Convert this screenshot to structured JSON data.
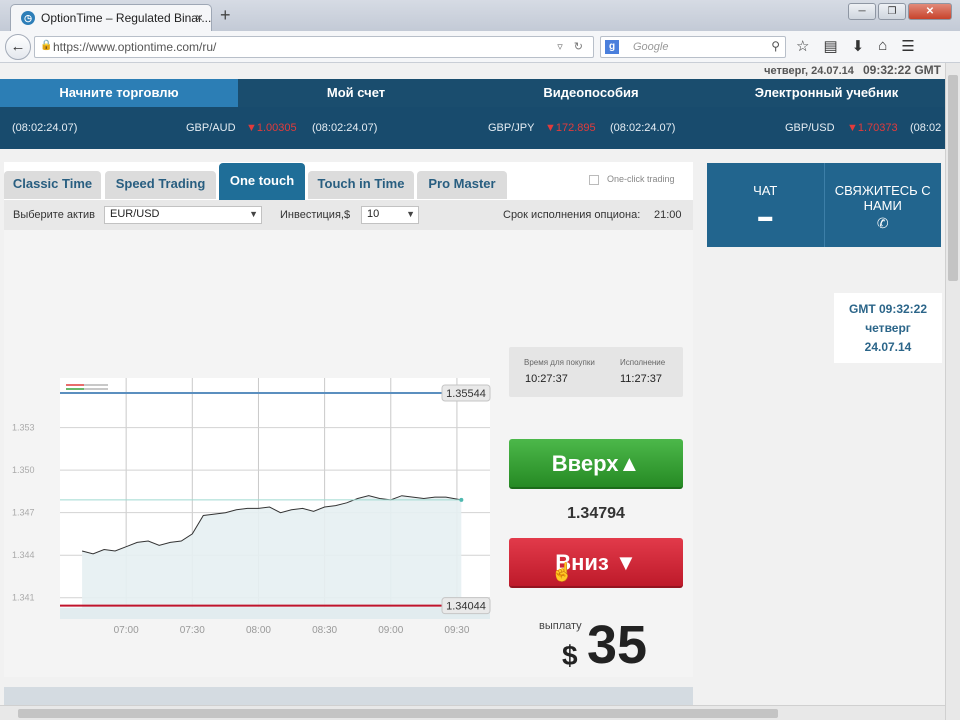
{
  "browser": {
    "tab_title": "OptionTime – Regulated Binar...",
    "tab_close": "×",
    "new_tab": "+",
    "url": "https://www.optiontime.com/ru/",
    "search_engine": "Google",
    "search_placeholder": "Google",
    "win_min": "─",
    "win_max": "❐",
    "win_close": "✕"
  },
  "site": {
    "date_line": "четверг, 24.07.14",
    "time_line": "09:32:22 GMT",
    "nav": [
      "Начните торговлю",
      "Мой счет",
      "Видеопособия",
      "Электронный учебник"
    ],
    "ticker": [
      {
        "time": "(08:02:24.07)",
        "pair": "GBP/AUD",
        "change": "▼1.00305"
      },
      {
        "time": "(08:02:24.07)",
        "pair": "GBP/JPY",
        "change": "▼172.895"
      },
      {
        "time": "(08:02:24.07)",
        "pair": "GBP/USD",
        "change": "▼1.70373"
      },
      {
        "time": "(08:02"
      }
    ]
  },
  "trade": {
    "tabs": [
      "Classic Time",
      "Speed Trading",
      "One touch",
      "Touch in Time",
      "Pro Master"
    ],
    "active_tab": "One touch",
    "one_click_label": "One-click trading",
    "asset_label": "Выберите актив",
    "asset_value": "EUR/USD",
    "invest_label": "Инвестиция,$",
    "invest_value": "10",
    "expiry_label": "Срок исполнения опциона:",
    "expiry_value": "21:00",
    "purchase_time_label": "Время для покупки",
    "purchase_time": "10:27:37",
    "execution_label": "Исполнение",
    "execution_time": "11:27:37",
    "up_label": "Вверх▲",
    "current_price": "1.34794",
    "down_label": "Вниз ▼",
    "payout_label": "выплату",
    "payout_currency": "$",
    "payout_value": "35"
  },
  "chart_data": {
    "type": "line",
    "x_ticks": [
      "07:00",
      "07:30",
      "08:00",
      "08:30",
      "09:00",
      "09:30"
    ],
    "y_ticks": [
      "1.353",
      "1.350",
      "1.347",
      "1.344",
      "1.341"
    ],
    "upper_barrier": "1.35544",
    "lower_barrier": "1.34044",
    "colors": {
      "upper": "#5b8fbf",
      "lower": "#c0142c",
      "price": "#333333",
      "fill": "#e6f0f2"
    },
    "series": [
      {
        "x": [
          "06:40",
          "06:45",
          "06:50",
          "06:55",
          "07:00",
          "07:05",
          "07:10",
          "07:15",
          "07:20",
          "07:25",
          "07:30",
          "07:35",
          "07:40",
          "07:45",
          "07:50",
          "07:55",
          "08:00",
          "08:05",
          "08:10",
          "08:15",
          "08:20",
          "08:25",
          "08:30",
          "08:35",
          "08:40",
          "08:45",
          "08:50",
          "08:55",
          "09:00",
          "09:05",
          "09:10",
          "09:15",
          "09:20",
          "09:25",
          "09:32"
        ],
        "values": [
          1.3443,
          1.3441,
          1.3444,
          1.3443,
          1.3446,
          1.3449,
          1.345,
          1.3447,
          1.3449,
          1.345,
          1.3455,
          1.3468,
          1.3469,
          1.347,
          1.3472,
          1.3473,
          1.3473,
          1.3474,
          1.347,
          1.3472,
          1.3473,
          1.3471,
          1.3474,
          1.3475,
          1.3477,
          1.348,
          1.3482,
          1.348,
          1.3479,
          1.3482,
          1.3481,
          1.348,
          1.3481,
          1.3481,
          1.3479
        ]
      }
    ]
  },
  "support": {
    "chat_label": "ЧАТ",
    "contact_label_1": "СВЯЖИТЕСЬ С",
    "contact_label_2": "НАМИ"
  },
  "gmt_widget": {
    "time": "GMT 09:32:22",
    "day": "четверг",
    "date": "24.07.14"
  }
}
